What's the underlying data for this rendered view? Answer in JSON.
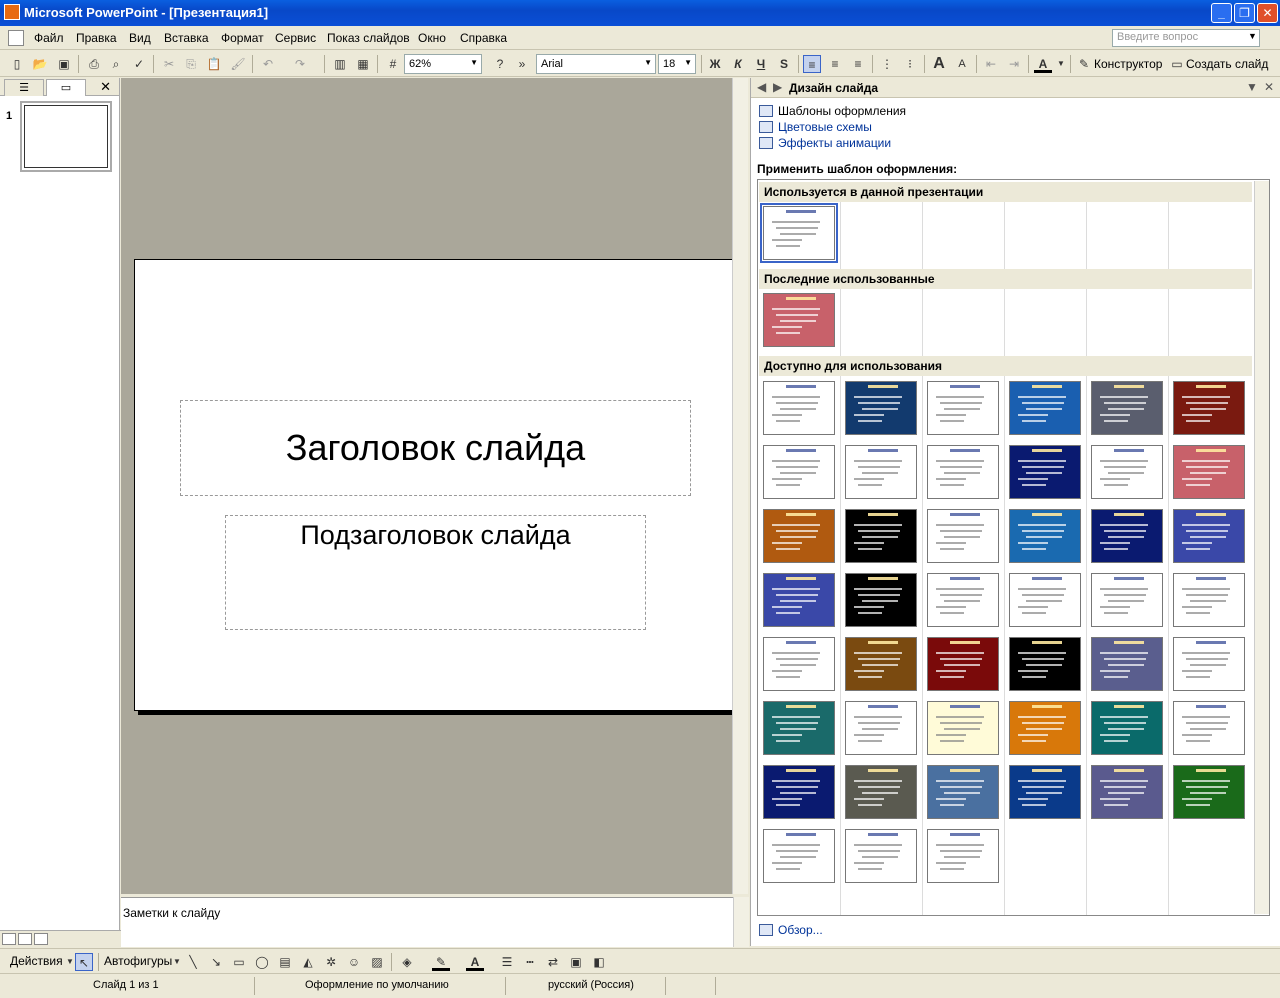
{
  "window": {
    "title": "Microsoft PowerPoint - [Презентация1]",
    "minimize": "_",
    "maximize": "❐",
    "close": "✕"
  },
  "menu": {
    "items": [
      "Файл",
      "Правка",
      "Вид",
      "Вставка",
      "Формат",
      "Сервис",
      "Показ слайдов",
      "Окно",
      "Справка"
    ],
    "help_placeholder": "Введите вопрос"
  },
  "toolbar": {
    "zoom": "62%",
    "font": "Arial",
    "size": "18",
    "bold": "Ж",
    "italic": "К",
    "underline": "Ч",
    "shadow": "S",
    "designer": "Конструктор",
    "new_slide": "Создать слайд"
  },
  "left_pane": {
    "slide_number": "1",
    "close": "✕"
  },
  "slide": {
    "title": "Заголовок слайда",
    "subtitle": "Подзаголовок слайда"
  },
  "notes": {
    "placeholder": "Заметки к слайду"
  },
  "task_pane": {
    "title": "Дизайн слайда",
    "links": [
      "Шаблоны оформления",
      "Цветовые схемы",
      "Эффекты анимации"
    ],
    "apply_label": "Применить шаблон оформления:",
    "sections": {
      "used": "Используется в данной презентации",
      "recent": "Последние использованные",
      "available": "Доступно для использования"
    },
    "browse": "Обзор..."
  },
  "thumbnail_colors": {
    "used": [
      "#ffffff"
    ],
    "recent": [
      "#c8616a"
    ],
    "available": [
      "#ffffff",
      "#123a6e",
      "#ffffff",
      "#1a5fb0",
      "#5a5e6e",
      "#7a1a10",
      "#ffffff",
      "#ffffff",
      "#ffffff",
      "#0a1a70",
      "#ffffff",
      "#c8616a",
      "#b05a10",
      "#000000",
      "#ffffff",
      "#1a6ab0",
      "#0a1a70",
      "#3a48a8",
      "#3a48a8",
      "#000000",
      "#ffffff",
      "#ffffff",
      "#ffffff",
      "#ffffff",
      "#ffffff",
      "#7a4a10",
      "#7a0a0a",
      "#000000",
      "#5a5e8e",
      "#ffffff",
      "#1a6a6a",
      "#ffffff",
      "#fffbd8",
      "#d8780a",
      "#0a6a6a",
      "#ffffff",
      "#0a1a70",
      "#5a5a50",
      "#4a70a0",
      "#0a3a8a",
      "#5a5a8e",
      "#1a6a1a",
      "#ffffff",
      "#ffffff",
      "#ffffff"
    ]
  },
  "drawing_toolbar": {
    "actions": "Действия",
    "autoshapes": "Автофигуры"
  },
  "status": {
    "slide": "Слайд 1 из 1",
    "design": "Оформление по умолчанию",
    "language": "русский (Россия)"
  }
}
